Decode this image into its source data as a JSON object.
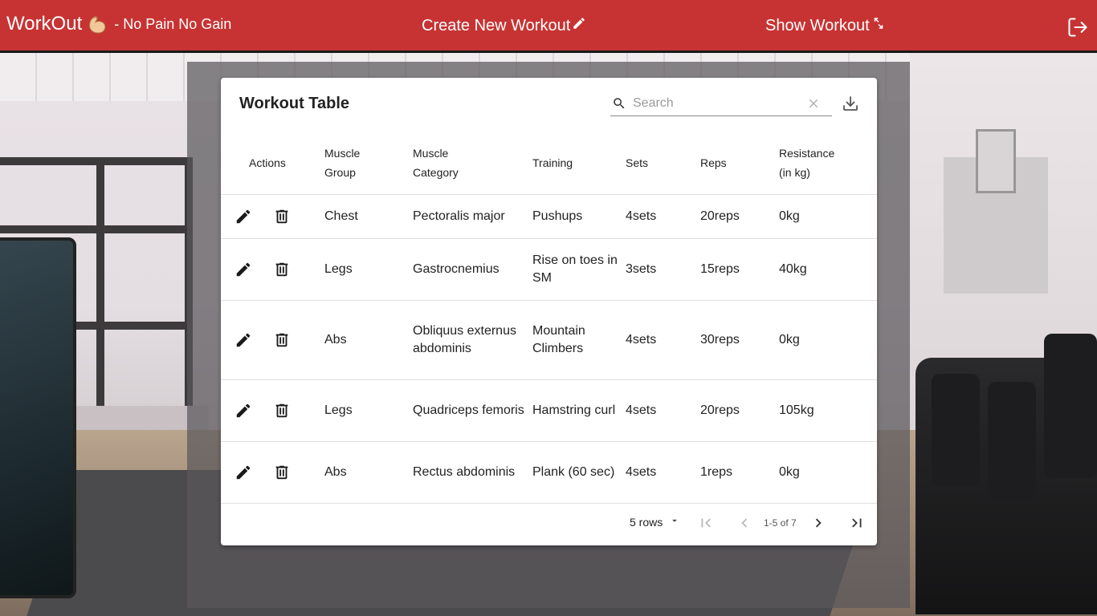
{
  "header": {
    "brand_title": "WorkOut",
    "brand_subtitle": "- No Pain No Gain",
    "nav_create": "Create New Workout",
    "nav_show": "Show Workout"
  },
  "table": {
    "title": "Workout Table",
    "search_placeholder": "Search",
    "columns": {
      "actions": "Actions",
      "muscle_group_1": "Muscle",
      "muscle_group_2": "Group",
      "muscle_category_1": "Muscle",
      "muscle_category_2": "Category",
      "training": "Training",
      "sets": "Sets",
      "reps": "Reps",
      "resistance_1": "Resistance",
      "resistance_2": "(in kg)"
    },
    "rows": [
      {
        "group": "Chest",
        "category": "Pectoralis major",
        "training": "Pushups",
        "sets": "4sets",
        "reps": "20reps",
        "resistance": "0kg"
      },
      {
        "group": "Legs",
        "category": "Gastrocnemius",
        "training": "Rise on toes in SM",
        "sets": "3sets",
        "reps": "15reps",
        "resistance": "40kg"
      },
      {
        "group": "Abs",
        "category": "Obliquus externus abdominis",
        "training": "Mountain Climbers",
        "sets": "4sets",
        "reps": "30reps",
        "resistance": "0kg"
      },
      {
        "group": "Legs",
        "category": "Quadriceps femoris",
        "training": "Hamstring curl",
        "sets": "4sets",
        "reps": "20reps",
        "resistance": "105kg"
      },
      {
        "group": "Abs",
        "category": "Rectus abdominis",
        "training": "Plank (60 sec)",
        "sets": "4sets",
        "reps": "1reps",
        "resistance": "0kg"
      }
    ]
  },
  "pagination": {
    "rows_per_page": "5 rows",
    "range": "1-5 of 7"
  },
  "icons": {
    "brand": "flexed-arm-icon",
    "create": "pencil-icon",
    "show": "expand-arrows-icon",
    "logout": "logout-icon",
    "search": "search-icon",
    "clear": "close-icon",
    "export": "download-icon",
    "edit": "edit-icon",
    "delete": "delete-icon"
  },
  "colors": {
    "header_bg": "#c73333",
    "card_bg": "#ffffff"
  }
}
